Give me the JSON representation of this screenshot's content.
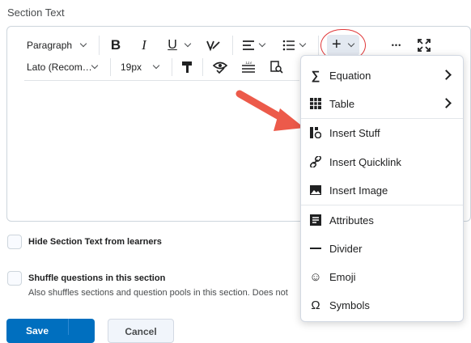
{
  "section_label": "Section Text",
  "toolbar": {
    "paragraph_select": "Paragraph",
    "font_select": "Lato (Recom…",
    "size_select": "19px",
    "bold_glyph": "B",
    "italic_glyph": "I",
    "underline_glyph": "U",
    "plus_glyph": "+",
    "more_glyph": "•••"
  },
  "insert_menu": {
    "items": [
      {
        "label": "Equation",
        "icon": "sigma-icon",
        "glyph": "∑",
        "submenu": true
      },
      {
        "label": "Table",
        "icon": "table-grid-icon",
        "glyph": "▦",
        "submenu": true
      },
      {
        "label": "Insert Stuff",
        "icon": "insert-stuff-icon",
        "glyph": "▮",
        "submenu": false
      },
      {
        "label": "Insert Quicklink",
        "icon": "link-icon",
        "glyph": "∞",
        "submenu": false
      },
      {
        "label": "Insert Image",
        "icon": "image-icon",
        "glyph": "▣",
        "submenu": false
      },
      {
        "label": "Attributes",
        "icon": "attributes-icon",
        "glyph": "☰",
        "submenu": false
      },
      {
        "label": "Divider",
        "icon": "divider-icon",
        "glyph": "—",
        "submenu": false
      },
      {
        "label": "Emoji",
        "icon": "emoji-icon",
        "glyph": "☺",
        "submenu": false
      },
      {
        "label": "Symbols",
        "icon": "omega-icon",
        "glyph": "Ω",
        "submenu": false
      }
    ]
  },
  "options": {
    "hide_label": "Hide Section Text from learners",
    "shuffle_label": "Shuffle questions in this section",
    "shuffle_desc": "Also shuffles sections and question pools in this section. Does not"
  },
  "buttons": {
    "save": "Save",
    "cancel": "Cancel"
  },
  "colors": {
    "accent": "#006fbf",
    "annotation_red": "#e0383a",
    "arrow": "#ec5a4a"
  }
}
